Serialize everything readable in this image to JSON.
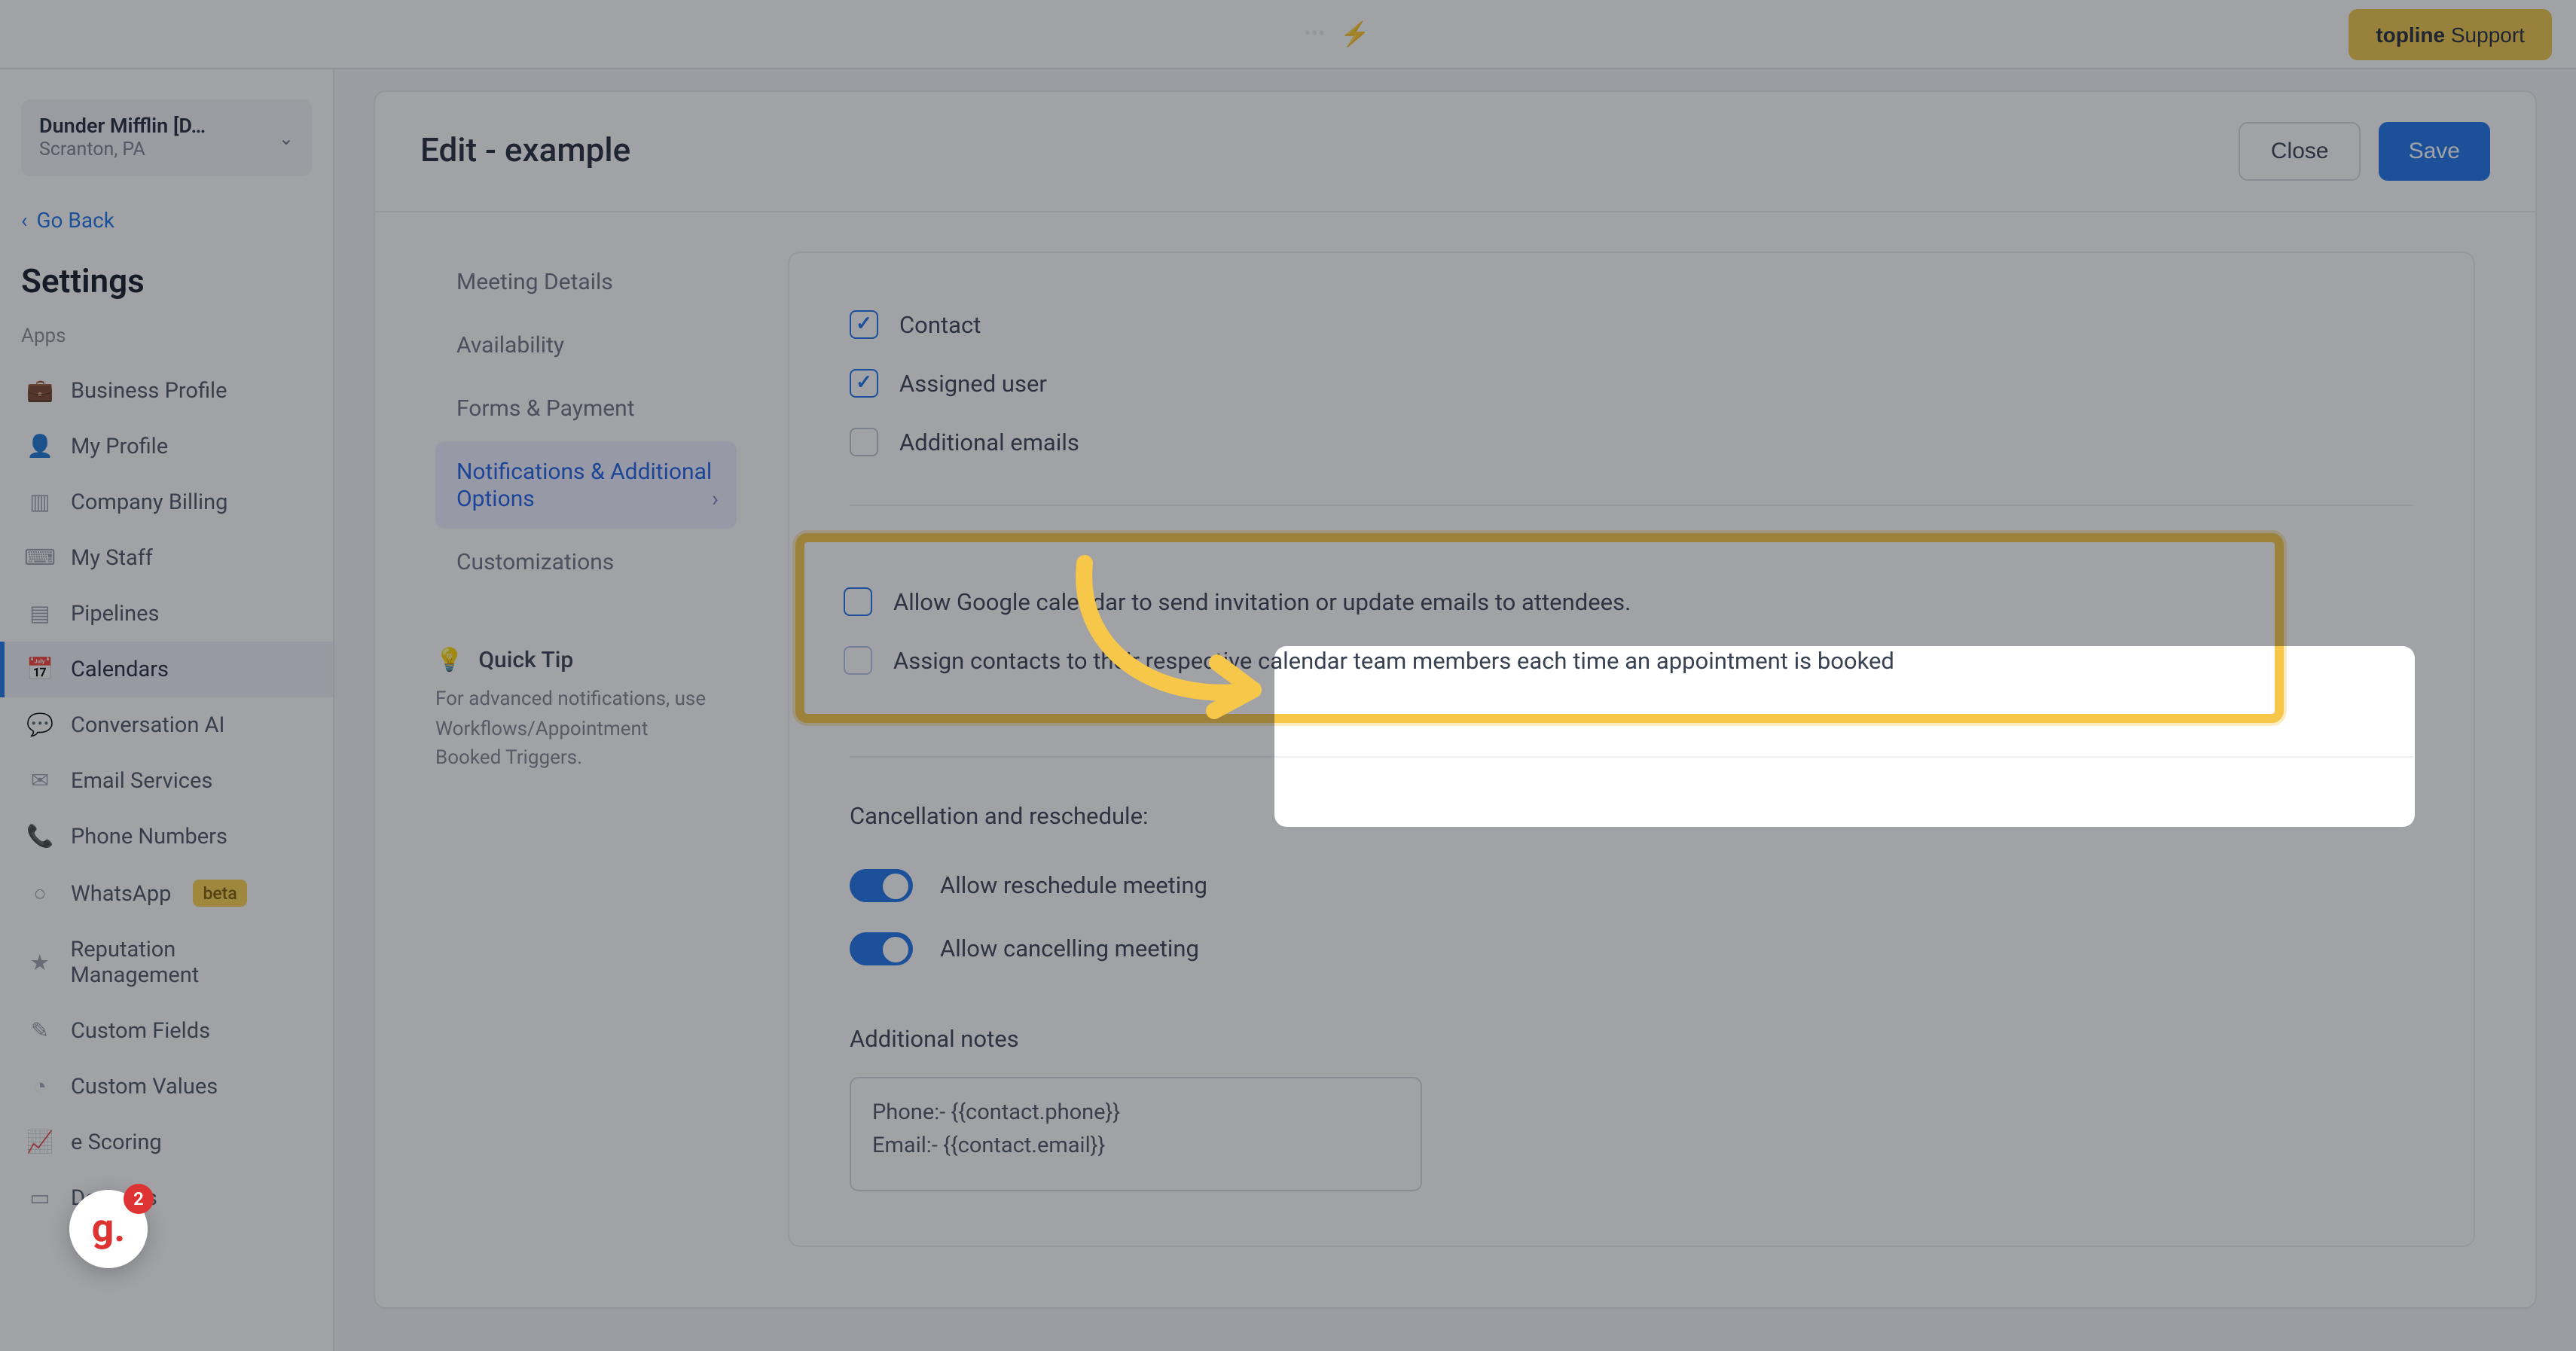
{
  "topbar": {
    "support_prefix": "topline",
    "support_word": "Support"
  },
  "sidebar": {
    "org_name": "Dunder Mifflin [D…",
    "org_loc": "Scranton, PA",
    "go_back": "Go Back",
    "title": "Settings",
    "section": "Apps",
    "items": [
      {
        "label": "Business Profile",
        "icon": "💼"
      },
      {
        "label": "My Profile",
        "icon": "👤"
      },
      {
        "label": "Company Billing",
        "icon": "▥"
      },
      {
        "label": "My Staff",
        "icon": "⌨"
      },
      {
        "label": "Pipelines",
        "icon": "▤"
      },
      {
        "label": "Calendars",
        "icon": "📅",
        "active": true
      },
      {
        "label": "Conversation AI",
        "icon": "💬"
      },
      {
        "label": "Email Services",
        "icon": "✉"
      },
      {
        "label": "Phone Numbers",
        "icon": "📞"
      },
      {
        "label": "WhatsApp",
        "icon": "○",
        "badge": "beta"
      },
      {
        "label": "Reputation Management",
        "icon": "★"
      },
      {
        "label": "Custom Fields",
        "icon": "✎"
      },
      {
        "label": "Custom Values",
        "icon": "◔"
      },
      {
        "label": "Scoring",
        "icon": "📈",
        "trimmed": "e Scoring"
      },
      {
        "label": "Domains",
        "icon": "▭"
      }
    ]
  },
  "panel": {
    "title": "Edit - example",
    "close": "Close",
    "save": "Save",
    "tabs": [
      "Meeting Details",
      "Availability",
      "Forms & Payment",
      "Notifications & Additional Options",
      "Customizations"
    ],
    "tip_title": "Quick Tip",
    "tip_body": "For advanced notifications, use Workflows/Appointment Booked Triggers.",
    "checks": {
      "contact": "Contact",
      "assigned": "Assigned user",
      "additional_emails": "Additional emails",
      "google_cal": "Allow Google calendar to send invitation or update emails to attendees.",
      "assign_contacts": "Assign contacts to their respective calendar team members each time an appointment is booked"
    },
    "cancel_head": "Cancellation and reschedule:",
    "toggle_reschedule": "Allow reschedule meeting",
    "toggle_cancel": "Allow cancelling meeting",
    "notes_head": "Additional notes",
    "notes_value": "Phone:- {{contact.phone}}\nEmail:- {{contact.email}}"
  },
  "float_badge": {
    "letter": "g.",
    "count": "2"
  }
}
